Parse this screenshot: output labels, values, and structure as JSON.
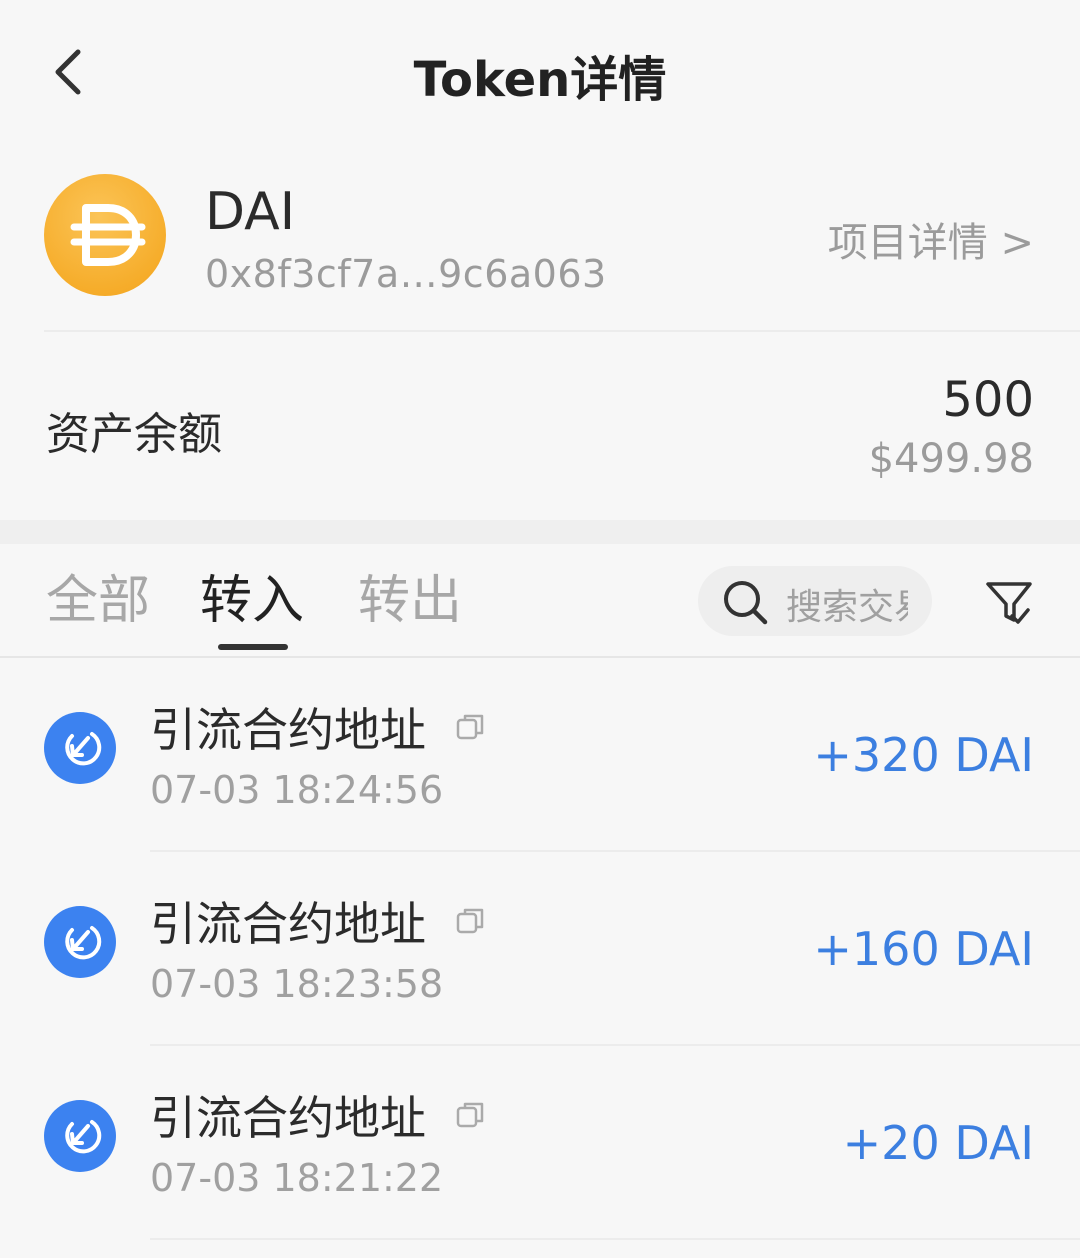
{
  "header": {
    "title": "Token详情",
    "back_icon": "chevron-left-icon"
  },
  "token": {
    "symbol": "DAI",
    "address": "0x8f3cf7a…9c6a063",
    "project_link": "项目详情 >",
    "logo_color": "#f6ad2b"
  },
  "balance": {
    "label": "资产余额",
    "amount": "500",
    "fiat": "$499.98"
  },
  "tabs": [
    {
      "label": "全部",
      "active": false
    },
    {
      "label": "转入",
      "active": true
    },
    {
      "label": "转出",
      "active": false
    }
  ],
  "search": {
    "placeholder": "搜索交易",
    "icon": "search-icon"
  },
  "filter": {
    "icon": "filter-icon"
  },
  "transactions": [
    {
      "title": "引流合约地址",
      "time": "07-03 18:24:56",
      "amount": "+320 DAI"
    },
    {
      "title": "引流合约地址",
      "time": "07-03 18:23:58",
      "amount": "+160 DAI"
    },
    {
      "title": "引流合约地址",
      "time": "07-03 18:21:22",
      "amount": "+20 DAI"
    }
  ],
  "colors": {
    "accent_blue": "#3c7fe0",
    "token_orange": "#f6ad2b",
    "muted_text": "#9b9b9b"
  }
}
